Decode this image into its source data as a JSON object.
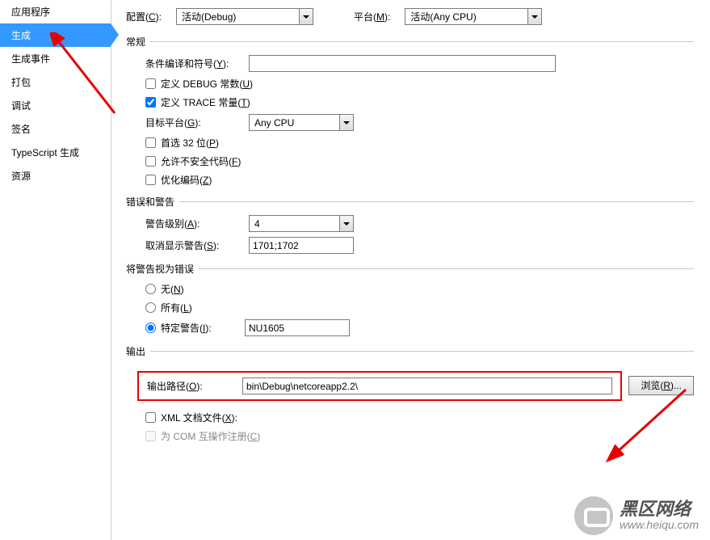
{
  "nav": {
    "items": [
      {
        "label": "应用程序"
      },
      {
        "label": "生成"
      },
      {
        "label": "生成事件"
      },
      {
        "label": "打包"
      },
      {
        "label": "调试"
      },
      {
        "label": "签名"
      },
      {
        "label": "TypeScript 生成"
      },
      {
        "label": "资源"
      }
    ],
    "selected_index": 1
  },
  "topbar": {
    "config_label_pre": "配置(",
    "config_key": "C",
    "config_label_post": "):",
    "config_value": "活动(Debug)",
    "platform_label_pre": "平台(",
    "platform_key": "M",
    "platform_label_post": "):",
    "platform_value": "活动(Any CPU)"
  },
  "groups": {
    "general": "常规",
    "errwarn": "错误和警告",
    "warn_as_err": "将警告视为错误",
    "output": "输出"
  },
  "general": {
    "cond_pre": "条件编译和符号(",
    "cond_key": "Y",
    "cond_post": "):",
    "cond_value": "",
    "debug_const": "定义 DEBUG 常数(",
    "debug_key": "U",
    "debug_post": ")",
    "trace_const": "定义 TRACE 常量(",
    "trace_key": "T",
    "trace_post": ")",
    "target_pre": "目标平台(",
    "target_key": "G",
    "target_post": "):",
    "target_value": "Any CPU",
    "prefer32_pre": "首选 32 位(",
    "prefer32_key": "P",
    "prefer32_post": ")",
    "unsafe_pre": "允许不安全代码(",
    "unsafe_key": "F",
    "unsafe_post": ")",
    "optimize_pre": "优化编码(",
    "optimize_key": "Z",
    "optimize_post": ")"
  },
  "errwarn": {
    "level_pre": "警告级别(",
    "level_key": "A",
    "level_post": "):",
    "level_value": "4",
    "suppress_pre": "取消显示警告(",
    "suppress_key": "S",
    "suppress_post": "):",
    "suppress_value": "1701;1702",
    "none_pre": "无(",
    "none_key": "N",
    "none_post": ")",
    "all_pre": "所有(",
    "all_key": "L",
    "all_post": ")",
    "specific_pre": "特定警告(",
    "specific_key": "I",
    "specific_post": "):",
    "specific_value": "NU1605"
  },
  "output": {
    "path_pre": "输出路径(",
    "path_key": "O",
    "path_post": "):",
    "path_value": "bin\\Debug\\netcoreapp2.2\\",
    "browse_pre": "浏览(",
    "browse_key": "R",
    "browse_post": ")...",
    "xml_pre": "XML 文档文件(",
    "xml_key": "X",
    "xml_post": "):",
    "com_pre": "为 COM 互操作注册(",
    "com_key": "C",
    "com_post": ")"
  },
  "watermark": {
    "title": "黑区网络",
    "url": "www.heiqu.com"
  }
}
